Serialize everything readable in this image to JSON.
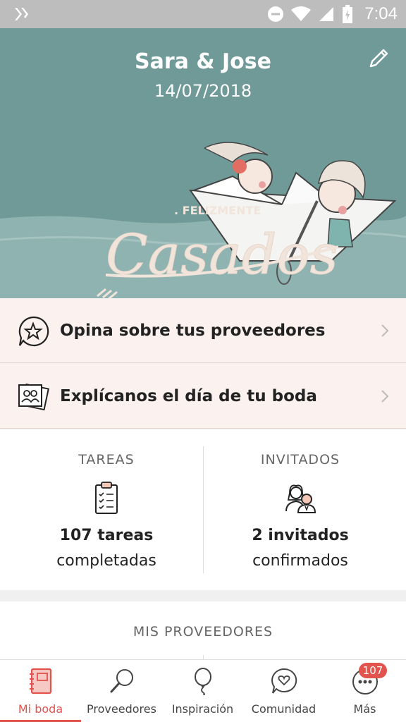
{
  "status_bar": {
    "time": "7:04",
    "icons": [
      "notification-icon",
      "do-not-disturb-icon",
      "wifi-icon",
      "signal-icon",
      "battery-icon"
    ]
  },
  "hero": {
    "couple_name": "Sara & Jose",
    "date": "14/07/2018",
    "illustration_text_small": ". FELIZMENTE",
    "illustration_text_big": "Casados",
    "colors": {
      "background": "#6f9a98",
      "water": "#8fb3b0"
    }
  },
  "actions": [
    {
      "label": "Opina sobre tus proveedores",
      "icon": "star-chat-icon"
    },
    {
      "label": "Explícanos el día de tu boda",
      "icon": "photos-icon"
    }
  ],
  "stats": {
    "tasks": {
      "title": "TAREAS",
      "count": "107 tareas",
      "sub": "completadas",
      "icon": "checklist-icon"
    },
    "guests": {
      "title": "INVITADOS",
      "count": "2 invitados",
      "sub": "confirmados",
      "icon": "guests-icon"
    }
  },
  "providers": {
    "title": "MIS PROVEEDORES"
  },
  "bottom_nav": {
    "items": [
      {
        "label": "Mi boda",
        "icon": "notebook-icon",
        "active": true
      },
      {
        "label": "Proveedores",
        "icon": "search-icon",
        "active": false
      },
      {
        "label": "Inspiración",
        "icon": "balloon-icon",
        "active": false
      },
      {
        "label": "Comunidad",
        "icon": "chat-heart-icon",
        "active": false
      },
      {
        "label": "Más",
        "icon": "more-icon",
        "active": false
      }
    ],
    "badge": "107",
    "accent": "#e2534d"
  }
}
